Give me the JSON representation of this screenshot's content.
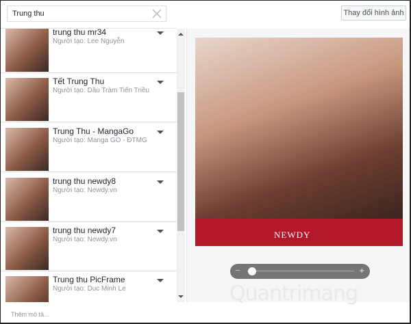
{
  "search": {
    "value": "Trung thu"
  },
  "change_image_button": "Thay đổi hình ảnh",
  "frames": [
    {
      "name": "trung thu mr34",
      "creator": "Người tạo: Lee Nguyễn"
    },
    {
      "name": "Tết Trung Thu",
      "creator": "Người tạo: Dầu Tràm Tiến Triều"
    },
    {
      "name": "Trung Thu - MangaGo",
      "creator": "Người tạo: Manga GO - ĐTMG"
    },
    {
      "name": "trung thu newdy8",
      "creator": "Người tạo: Newdy.vn"
    },
    {
      "name": "trung thu newdy7",
      "creator": "Người tạo: Newdy.vn"
    },
    {
      "name": "Trung thu PicFrame",
      "creator": "Người tạo: Duc Minh Le"
    }
  ],
  "preview": {
    "brand": "NEWDY"
  },
  "zoom": {
    "minus": "−",
    "plus": "+",
    "level": 0.05
  },
  "watermark": "Quantrimang",
  "description_placeholder": "Thêm mô tả..."
}
